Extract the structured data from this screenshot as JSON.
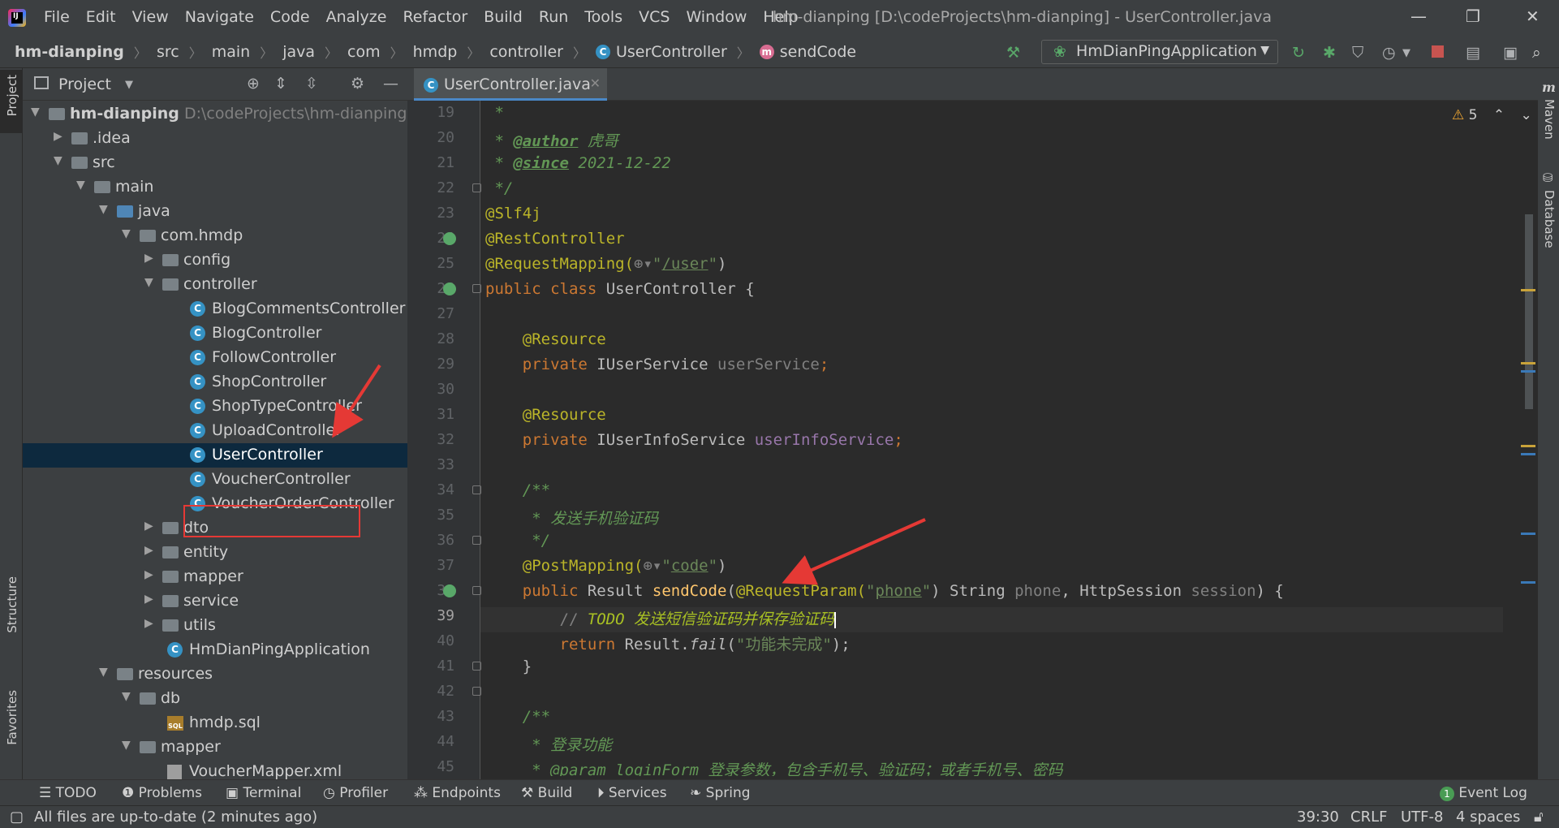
{
  "menu": [
    "File",
    "Edit",
    "View",
    "Navigate",
    "Code",
    "Analyze",
    "Refactor",
    "Build",
    "Run",
    "Tools",
    "VCS",
    "Window",
    "Help"
  ],
  "window_title": "hm-dianping [D:\\codeProjects\\hm-dianping] - UserController.java",
  "breadcrumbs": [
    "hm-dianping",
    "src",
    "main",
    "java",
    "com",
    "hmdp",
    "controller",
    "UserController",
    "sendCode"
  ],
  "run_config": "HmDianPingApplication",
  "project_panel": {
    "title": "Project",
    "root": {
      "name": "hm-dianping",
      "path": "D:\\codeProjects\\hm-dianping"
    },
    "items": [
      ".idea",
      "src",
      "main",
      "java",
      "com.hmdp",
      "config",
      "controller",
      "BlogCommentsController",
      "BlogController",
      "FollowController",
      "ShopController",
      "ShopTypeController",
      "UploadController",
      "UserController",
      "VoucherController",
      "VoucherOrderController",
      "dto",
      "entity",
      "mapper",
      "service",
      "utils",
      "HmDianPingApplication",
      "resources",
      "db",
      "hmdp.sql",
      "mapper",
      "VoucherMapper.xml"
    ]
  },
  "editor": {
    "tab": "UserController.java",
    "warnings": "5",
    "line_numbers": [
      "19",
      "20",
      "21",
      "22",
      "23",
      "24",
      "25",
      "26",
      "27",
      "28",
      "29",
      "30",
      "31",
      "32",
      "33",
      "34",
      "35",
      "36",
      "37",
      "38",
      "39",
      "40",
      "41",
      "42",
      "43",
      "44",
      "45"
    ],
    "current_line": "39"
  },
  "code": {
    "l19": " *",
    "l20_a": " * ",
    "l20_tag": "@author",
    "l20_b": " 虎哥",
    "l21_a": " * ",
    "l21_tag": "@since",
    "l21_b": " 2021-12-22",
    "l22": " */",
    "l23": "@Slf4j",
    "l24": "@RestController",
    "l25_a": "@RequestMapping(",
    "l25_s1": "\"",
    "l25_s2": "/user",
    "l25_s3": "\"",
    "l25_b": ")",
    "l26_a": "public class ",
    "l26_b": "UserController {",
    "l28": "    @Resource",
    "l29_a": "    private ",
    "l29_b": "IUserService ",
    "l29_c": "userService",
    "l29_d": ";",
    "l31": "    @Resource",
    "l32_a": "    private ",
    "l32_b": "IUserInfoService ",
    "l32_c": "userInfoService",
    "l32_d": ";",
    "l34": "    /**",
    "l35": "     * 发送手机验证码",
    "l36": "     */",
    "l37_a": "    @PostMapping(",
    "l37_s1": "\"",
    "l37_s2": "code",
    "l37_s3": "\"",
    "l37_b": ")",
    "l38_a": "    public ",
    "l38_b": "Result ",
    "l38_c": "sendCode",
    "l38_d": "(",
    "l38_e": "@RequestParam(",
    "l38_f1": "\"",
    "l38_f2": "phone",
    "l38_f3": "\"",
    "l38_g": ") String ",
    "l38_h": "phone",
    "l38_i": ", HttpSession ",
    "l38_j": "session",
    "l38_k": ") {",
    "l39_a": "        // ",
    "l39_b": "TODO 发送短信验证码并保存验证码",
    "l40_a": "        return ",
    "l40_b": "Result.",
    "l40_c": "fail",
    "l40_d": "(",
    "l40_e": "\"功能未完成\"",
    "l40_f": ");",
    "l41": "    }",
    "l43": "    /**",
    "l44": "     * 登录功能",
    "l45": "     * @param loginForm 登录参数，包含手机号、验证码；或者手机号、密码"
  },
  "left_strip": [
    "Project",
    "Structure",
    "Favorites"
  ],
  "right_strip": [
    "Maven",
    "Database"
  ],
  "bottom_tools": [
    "TODO",
    "Problems",
    "Terminal",
    "Profiler",
    "Endpoints",
    "Build",
    "Services",
    "Spring"
  ],
  "event_log": {
    "count": "1",
    "label": "Event Log"
  },
  "status": {
    "message": "All files are up-to-date (2 minutes ago)",
    "position": "39:30",
    "line_sep": "CRLF",
    "encoding": "UTF-8",
    "indent": "4 spaces"
  },
  "colors": {
    "accent": "#4a88c7",
    "selection": "#0d293e",
    "annotation_red": "#e53935"
  }
}
